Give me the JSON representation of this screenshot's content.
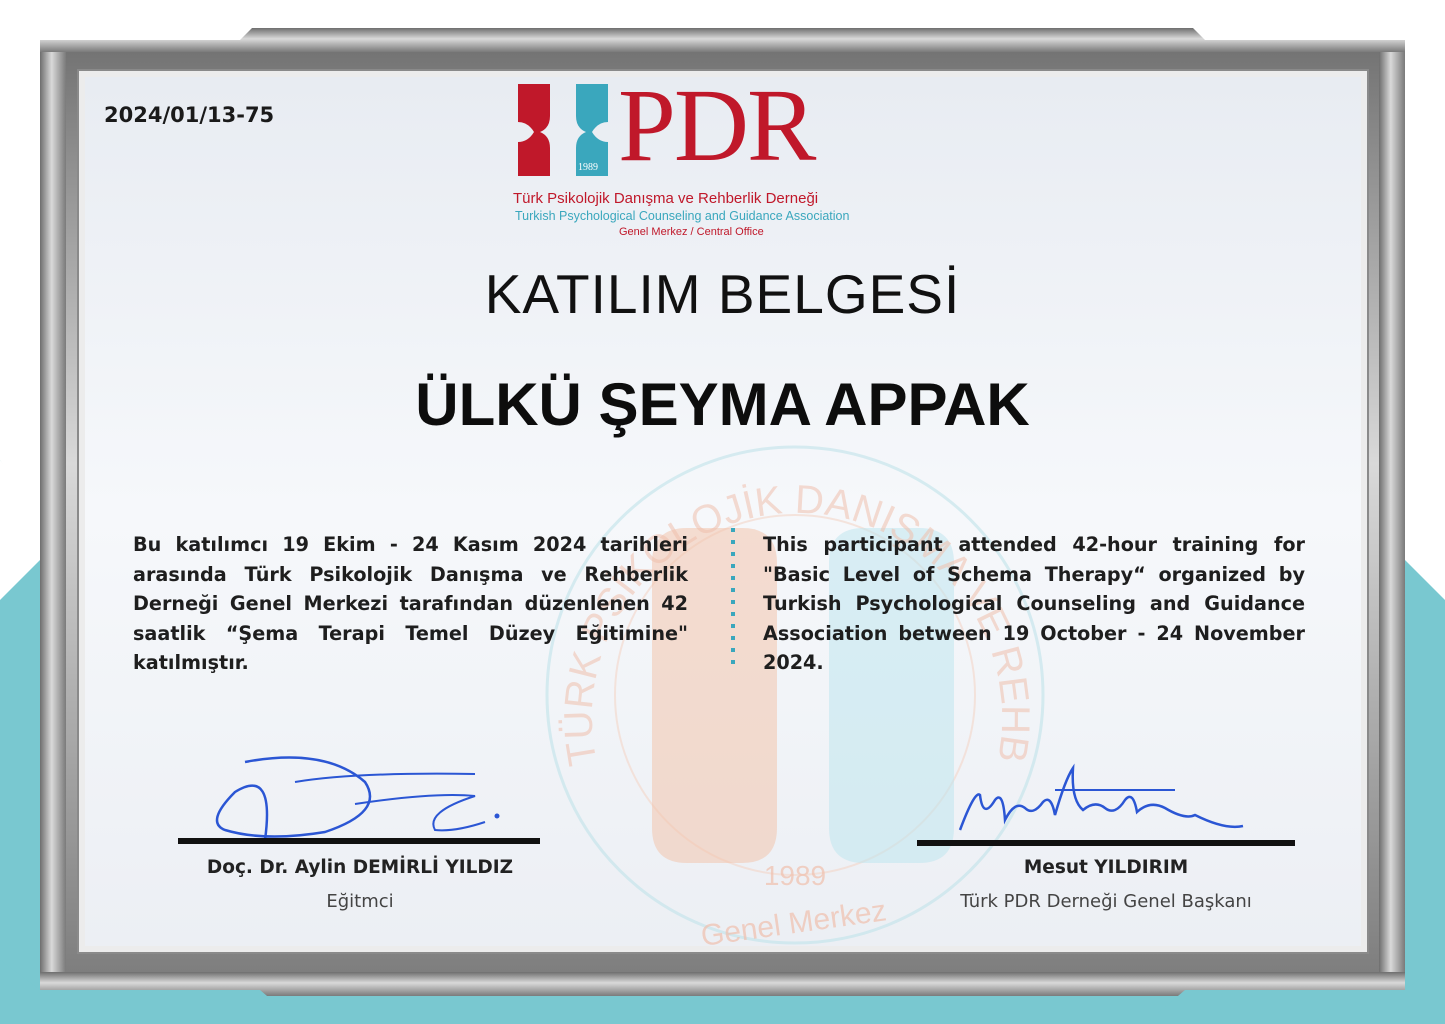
{
  "certificate": {
    "number": "2024/01/13-75",
    "title": "KATILIM BELGESİ",
    "recipient": "ÜLKÜ ŞEYMA APPAK"
  },
  "logo": {
    "year": "1989",
    "wordmark": "PDR",
    "name_tr": "Türk Psikolojik Danışma ve Rehberlik Derneği",
    "name_en": "Turkish Psychological Counseling and Guidance Association",
    "office": "Genel Merkez / Central Office"
  },
  "seal": {
    "ring_text": "TÜRK PSİKOLOJİK DANIŞMA VE REHBERLİK DERNEĞİ",
    "year": "1989",
    "office": "Genel Merkez"
  },
  "body": {
    "text_tr": "Bu katılımcı 19 Ekim - 24 Kasım 2024 tarihleri arasında Türk Psikolojik Danışma ve Rehberlik Derneği Genel Merkezi tarafından düzenlenen 42 saatlik “Şema Terapi Temel Düzey Eğitimine\" katılmıştır.",
    "text_en": "This participant attended 42-hour training for \"Basic Level of Schema Therapy“ organized by Turkish Psychological Counseling and Guidance Association between 19 October - 24 November 2024."
  },
  "signatories": [
    {
      "name": "Doç. Dr. Aylin DEMİRLİ YILDIZ",
      "role": "Eğitmci"
    },
    {
      "name": "Mesut YILDIRIM",
      "role": "Türk PDR Derneği Genel Başkanı"
    }
  ],
  "colors": {
    "brand_red": "#c0182a",
    "brand_teal": "#3aa7bd",
    "frame_silver": "#9a9a9a",
    "frame_teal": "#79c8d0",
    "signature_blue": "#2b56d4"
  }
}
